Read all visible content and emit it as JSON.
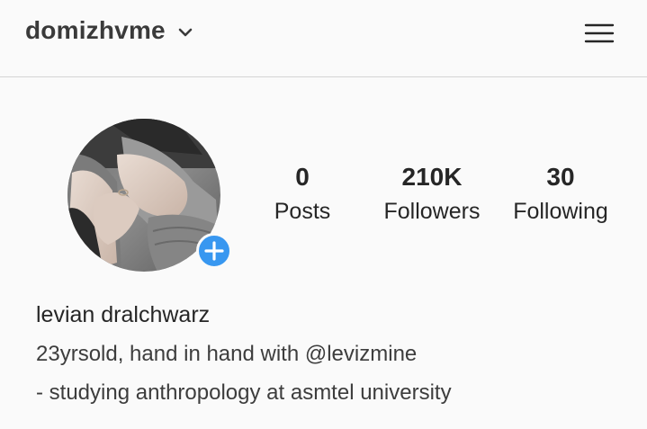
{
  "header": {
    "username": "domizhvme",
    "account_switcher_icon": "chevron-down-icon",
    "menu_icon": "hamburger-menu-icon"
  },
  "profile": {
    "avatar_badge_icon": "plus-icon",
    "accent_color": "#3897f0",
    "stats": [
      {
        "value": "0",
        "label": "Posts"
      },
      {
        "value": "210K",
        "label": "Followers"
      },
      {
        "value": "30",
        "label": "Following"
      }
    ],
    "name": "levian dralchwarz",
    "bio_lines": [
      "23yrsold, hand in hand with @levizmine",
      "- studying anthropology at asmtel university"
    ]
  }
}
